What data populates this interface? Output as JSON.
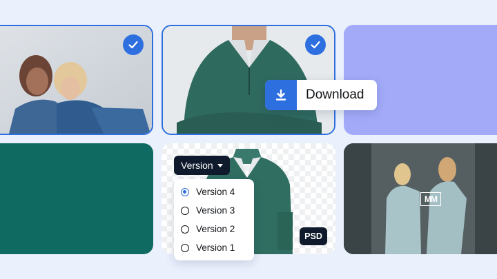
{
  "colors": {
    "page_background": "#eaf0fc",
    "accent_blue": "#2e6fe0",
    "lavender_tile": "#a3abf9",
    "teal_tile": "#0f6a62",
    "dark_chip": "#0f1a2c"
  },
  "tiles": [
    {
      "kind": "photo",
      "subject": "two women in denim",
      "selected": true
    },
    {
      "kind": "photo",
      "subject": "green zip sweater",
      "selected": true
    },
    {
      "kind": "color",
      "color": "#a3abf9"
    },
    {
      "kind": "color",
      "color": "#0f6a62"
    },
    {
      "kind": "cutout",
      "subject": "green jacket on transparent background"
    },
    {
      "kind": "photo",
      "subject": "two women in light blue suits"
    }
  ],
  "download": {
    "label": "Download",
    "icon": "download-icon"
  },
  "version": {
    "button_label": "Version",
    "options": [
      {
        "label": "Version 4",
        "selected": true
      },
      {
        "label": "Version 3",
        "selected": false
      },
      {
        "label": "Version 2",
        "selected": false
      },
      {
        "label": "Version 1",
        "selected": false
      }
    ]
  },
  "psd_badge": "PSD",
  "logo_text": "MM"
}
